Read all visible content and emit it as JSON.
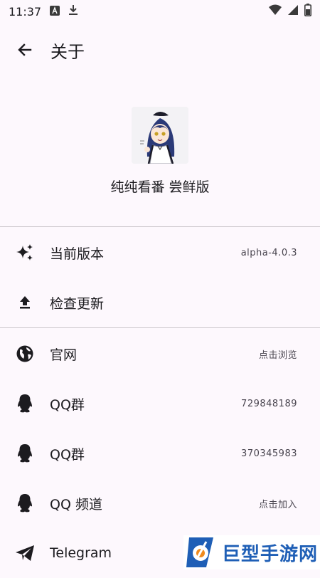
{
  "status": {
    "time": "11:37"
  },
  "header": {
    "title": "关于"
  },
  "app": {
    "name": "纯纯看番 尝鲜版"
  },
  "items": [
    {
      "label": "当前版本",
      "value": "alpha-4.0.3"
    },
    {
      "label": "检查更新",
      "value": ""
    },
    {
      "label": "官网",
      "value": "点击浏览"
    },
    {
      "label": "QQ群",
      "value": "729848189"
    },
    {
      "label": "QQ群",
      "value": "370345983"
    },
    {
      "label": "QQ 频道",
      "value": "点击加入"
    },
    {
      "label": "Telegram",
      "value": ""
    }
  ],
  "watermark": {
    "text": "巨型手游网"
  }
}
